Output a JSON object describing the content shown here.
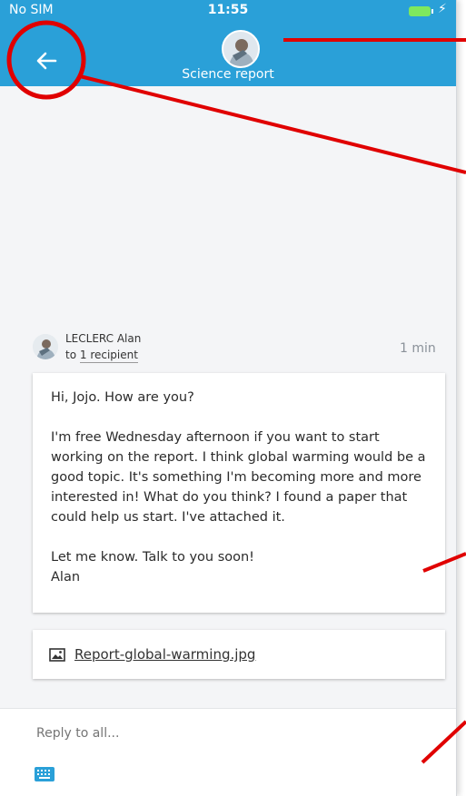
{
  "status": {
    "carrier": "No SIM",
    "time": "11:55"
  },
  "header": {
    "title": "Science report"
  },
  "message": {
    "sender": "LECLERC Alan",
    "to_prefix": "to",
    "recipients": "1 recipient",
    "time": "1 min",
    "body": [
      "Hi, Jojo. How are you?",
      "I'm free Wednesday afternoon if you want to start working on the report. I think global warming would be a good topic. It's something I'm becoming more and more interested in! What do you think? I found a paper that could help us start. I've attached it.",
      "Let me know. Talk to you soon!",
      "Alan"
    ]
  },
  "attachment": {
    "name": "Report-global-warming.jpg",
    "icon": "image-icon"
  },
  "reply": {
    "placeholder": "Reply to all...",
    "icon": "keyboard-icon"
  },
  "colors": {
    "accent": "#2aa0d8",
    "annotation": "#e00000"
  }
}
